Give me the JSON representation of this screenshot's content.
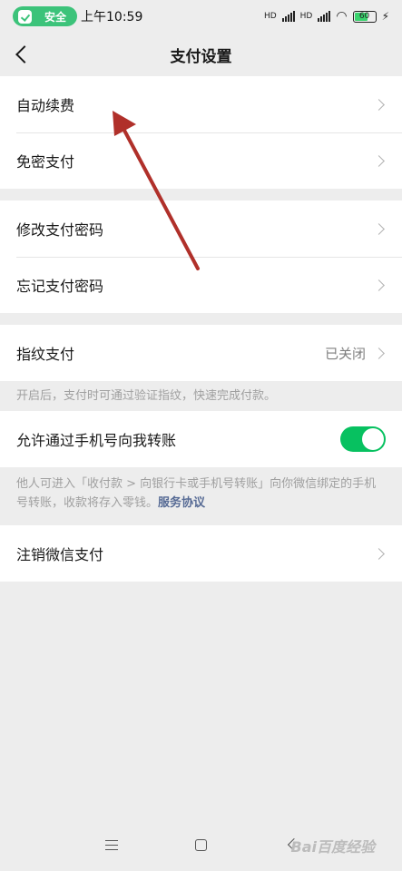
{
  "status_bar": {
    "safety_label": "安全",
    "time": "上午10:59",
    "network_1": "HD",
    "network_2": "HD",
    "battery": "60"
  },
  "header": {
    "title": "支付设置",
    "back_icon": "chevron-left-icon"
  },
  "groups": {
    "auto_renew": "自动续费",
    "password_free": "免密支付",
    "change_password": "修改支付密码",
    "forgot_password": "忘记支付密码",
    "fingerprint_label": "指纹支付",
    "fingerprint_value": "已关闭",
    "fingerprint_hint": "开启后，支付时可通过验证指纹，快速完成付款。",
    "phone_transfer_label": "允许通过手机号向我转账",
    "phone_transfer_enabled": true,
    "phone_transfer_hint": "他人可进入「收付款 > 向银行卡或手机号转账」向你微信绑定的手机号转账，收款将存入零钱。",
    "service_agreement": "服务协议",
    "close_wechat_pay": "注销微信支付"
  },
  "colors": {
    "accent_green": "#07c160",
    "link_blue": "#576b95",
    "annotation_red": "#b0302a"
  },
  "system_nav": {
    "menu_icon": "menu-icon",
    "home_icon": "home-square-icon",
    "back_icon": "back-triangle-icon",
    "watermark": "Bai百度经验"
  }
}
